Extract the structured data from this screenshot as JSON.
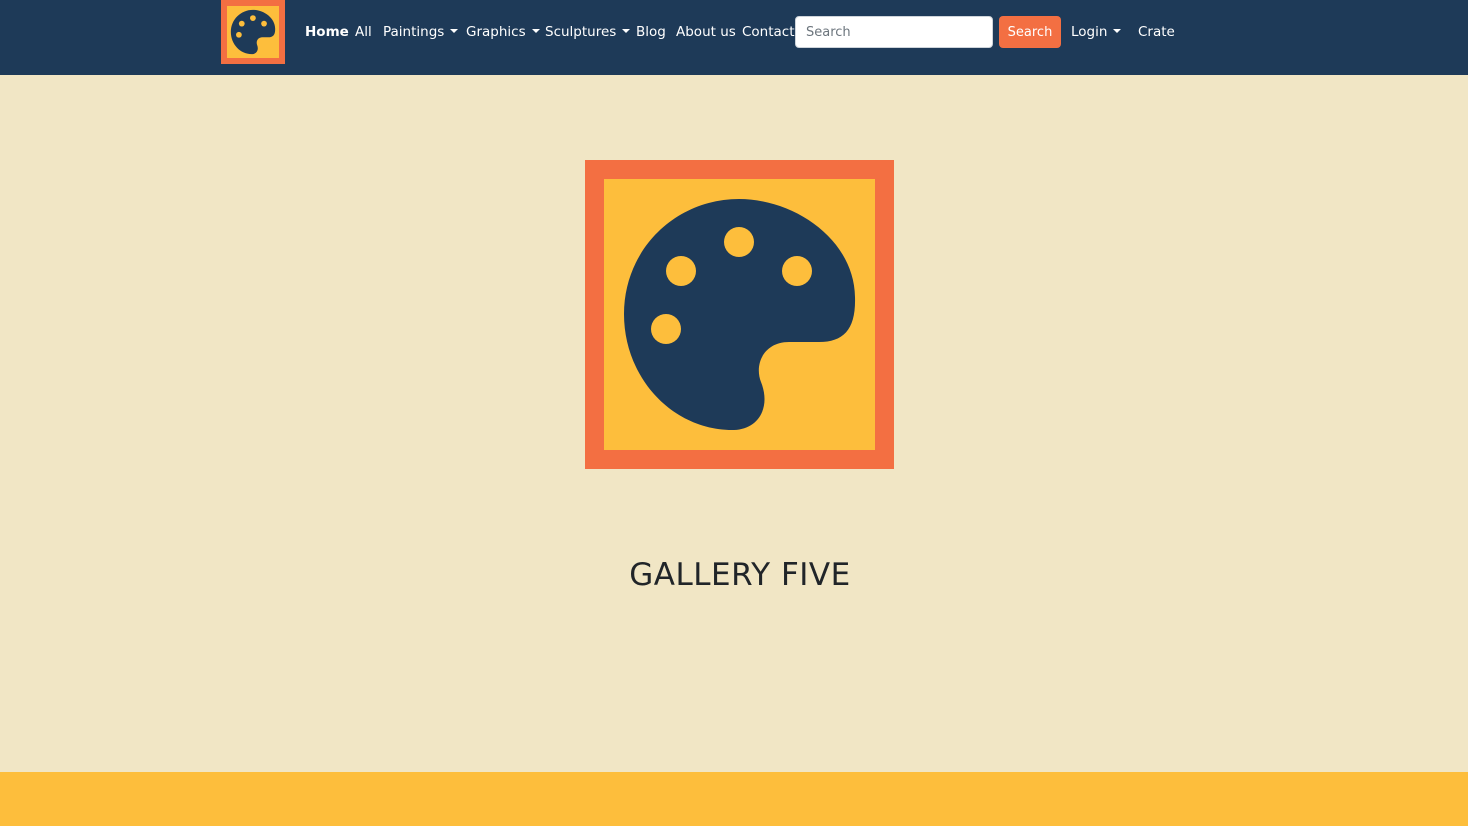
{
  "navbar": {
    "brand_icon": "palette-icon",
    "links": [
      {
        "label": "Home",
        "active": true
      },
      {
        "label": "All"
      },
      {
        "label": "Paintings",
        "dropdown": true
      },
      {
        "label": "Graphics",
        "dropdown": true
      },
      {
        "label": "Sculptures",
        "dropdown": true
      },
      {
        "label": "Blog"
      },
      {
        "label": "About us"
      },
      {
        "label": "Contact"
      }
    ],
    "search": {
      "placeholder": "Search",
      "value": "",
      "button_label": "Search"
    },
    "login": {
      "label": "Login",
      "dropdown": true
    },
    "crate": {
      "label": "Crate"
    }
  },
  "hero": {
    "icon": "palette-icon",
    "title": "GALLERY FIVE"
  },
  "colors": {
    "navbar_bg": "#1e3a58",
    "page_bg": "#f1e6c5",
    "accent_orange": "#f36f42",
    "accent_yellow": "#fdbe3c",
    "footer_bg": "#fdbe3c"
  }
}
